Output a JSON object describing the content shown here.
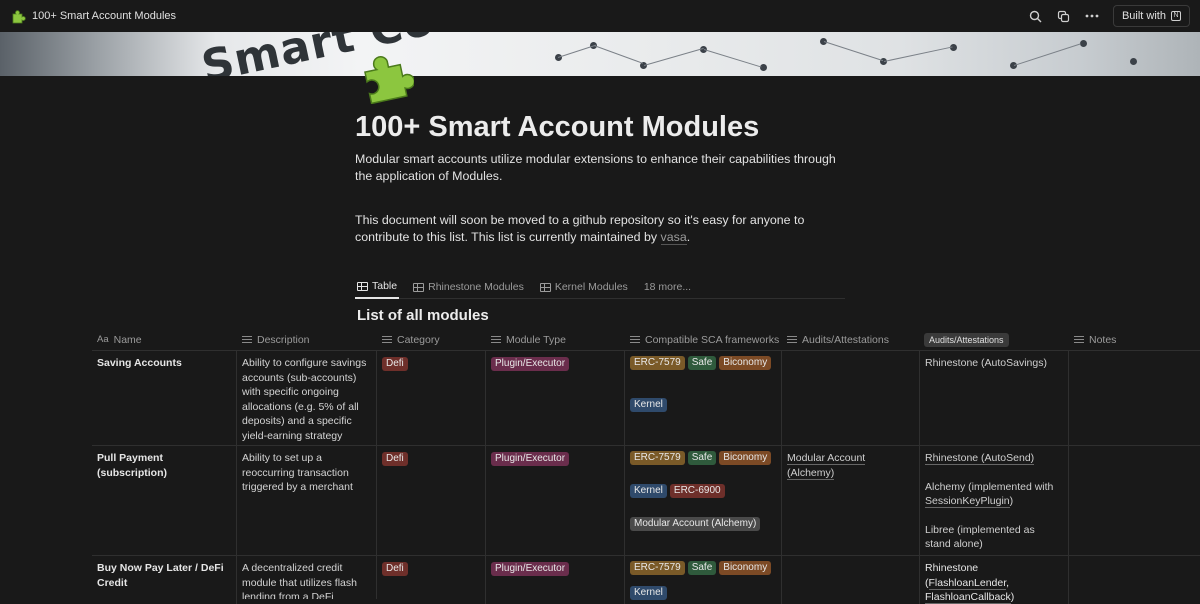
{
  "window": {
    "title": "100+ Smart Account Modules",
    "built_with": "Built with"
  },
  "cover": {
    "text": "Smart Co"
  },
  "page": {
    "title": "100+ Smart Account Modules",
    "para1": "Modular smart accounts utilize modular extensions to enhance their capabilities through the application of Modules.",
    "para2_before": "This document will soon be moved to a github repository so it's easy for anyone to contribute to this list. This list is currently maintained by ",
    "para2_link": "vasa",
    "para2_after": "."
  },
  "tabs": [
    {
      "label": "Table"
    },
    {
      "label": "Rhinestone Modules"
    },
    {
      "label": "Kernel Modules"
    },
    {
      "label": "18 more..."
    }
  ],
  "database": {
    "title": "List of all modules"
  },
  "columns": {
    "name": "Name",
    "name_prefix": "Aa",
    "description": "Description",
    "category": "Category",
    "module_type": "Module Type",
    "sca": "Compatible SCA frameworks",
    "audits1": "Audits/Attestations",
    "audits2": "Audits/Attestations",
    "notes": "Notes"
  },
  "colors": {
    "defi_bg": "#6e2f2a",
    "plugin_bg": "#6a2d4c",
    "erc7579_bg": "#7a5a28",
    "safe_bg": "#2f5a3c",
    "biconomy_bg": "#7c4a25",
    "kernel_bg": "#2f4a6b",
    "gray_bg": "#4a4a4a"
  },
  "rows": [
    {
      "name": "Saving Accounts",
      "description": "Ability to configure savings accounts (sub-accounts) with specific ongoing allocations (e.g. 5% of all deposits) and a specific yield-earning strategy",
      "category": "Defi",
      "module_type": "Plugin/Executor",
      "sca": [
        "ERC-7579",
        "Safe",
        "Biconomy",
        "Kernel"
      ],
      "audits1": "",
      "audits2": "Rhinestone (AutoSavings)"
    },
    {
      "name": "Pull Payment (subscription)",
      "description": "Ability to set up a reoccurring transaction triggered by a merchant",
      "category": "Defi",
      "module_type": "Plugin/Executor",
      "sca": [
        "ERC-7579",
        "Safe",
        "Biconomy",
        "Kernel",
        "ERC-6900",
        "Modular Account (Alchemy)"
      ],
      "audits1": "Modular Account (Alchemy)",
      "audits2_a": "Rhinestone (AutoSend)",
      "audits2_b1": "Alchemy (implemented with ",
      "audits2_b2": "SessionKeyPlugin",
      "audits2_b3": ")",
      "audits2_c": "Libree (implemented as stand alone)"
    },
    {
      "name": "Buy Now Pay Later / DeFi Credit",
      "description": "A decentralized credit module that utilizes flash lending from a DeFi protocol",
      "category": "Defi",
      "module_type": "Plugin/Executor",
      "sca": [
        "ERC-7579",
        "Safe",
        "Biconomy",
        "Kernel"
      ],
      "audits1": "",
      "audits2_a": "Rhinestone (",
      "audits2_b": "FlashloanLender",
      "audits2_c": ", ",
      "audits2_d": "FlashloanCallback",
      "audits2_e": ")"
    }
  ]
}
